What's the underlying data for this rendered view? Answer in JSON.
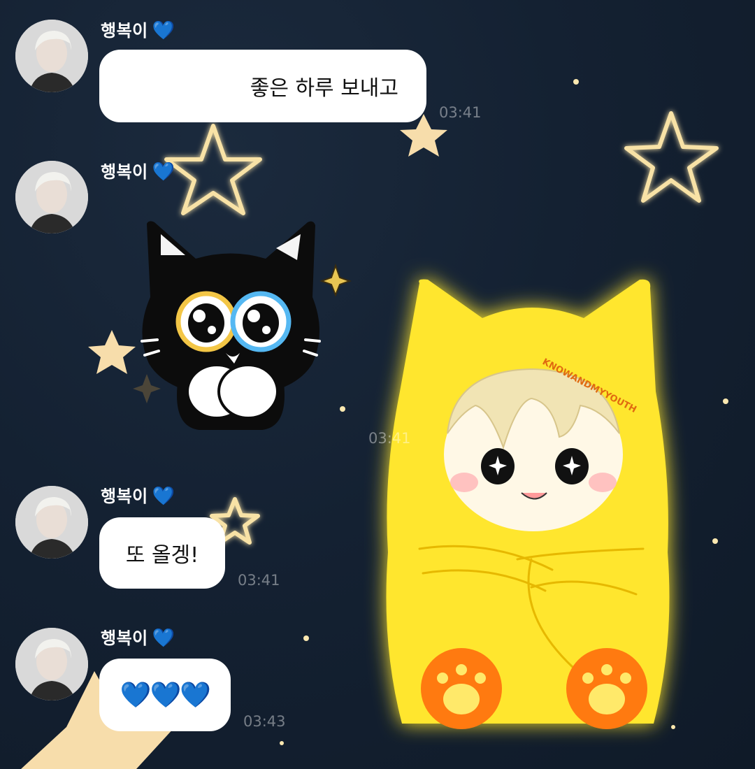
{
  "chat": {
    "messages": [
      {
        "sender": "행복이",
        "heart": "💙",
        "text": "좋은 하루 보내고",
        "time": "03:41",
        "type": "text"
      },
      {
        "sender": "행복이",
        "heart": "💙",
        "type": "sticker",
        "sticker": "black-cat-sticker",
        "time": "03:41"
      },
      {
        "sender": "행복이",
        "heart": "💙",
        "text": "또 올겡!",
        "time": "03:41",
        "type": "text"
      },
      {
        "sender": "행복이",
        "heart": "💙",
        "text": "💙💙💙",
        "time": "03:43",
        "type": "text"
      }
    ]
  },
  "wallpaper": {
    "signature": "KNOWANDMYYOUTH",
    "colors": {
      "background": "#142132",
      "star": "#fbe8b0",
      "blanket": "#ffe52b",
      "paw": "#ff7a10"
    }
  }
}
